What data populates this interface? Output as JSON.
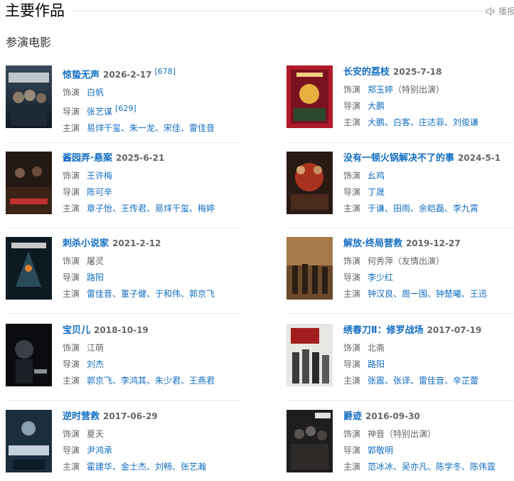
{
  "header": {
    "title": "主要作品",
    "play_label": "播报"
  },
  "section": {
    "title": "参演电影"
  },
  "labels": {
    "role": "饰演",
    "director": "导演",
    "cast": "主演"
  },
  "colors": {
    "link": "#136ec2",
    "muted": "#666666",
    "divider": "#ececec"
  },
  "movies": [
    {
      "title": "惊蛰无声",
      "date": "2026-2-17",
      "title_cite": "[678]",
      "role": "白帆",
      "role_note": "",
      "director": "张艺谋",
      "director_cite": "[629]",
      "cast": "易烊千玺、朱一龙、宋佳、雷佳音"
    },
    {
      "title": "长安的荔枝",
      "date": "2025-7-18",
      "title_cite": "",
      "role": "郑玉婷",
      "role_note": "（特别出演）",
      "director": "大鹏",
      "director_cite": "",
      "cast": "大鹏、白客、庄达菲、刘俊谦"
    },
    {
      "title": "酱园弄·悬案",
      "date": "2025-6-21",
      "title_cite": "",
      "role": "王许梅",
      "role_note": "",
      "director": "陈可辛",
      "director_cite": "",
      "cast": "章子怡、王传君、易烊千玺、梅婷"
    },
    {
      "title": "没有一顿火锅解决不了的事",
      "date": "2024-5-1",
      "title_cite": "",
      "role": "幺鸡",
      "role_note": "",
      "director": "丁晟",
      "director_cite": "",
      "cast": "于谦、田雨、余皑磊、李九霄"
    },
    {
      "title": "刺杀小说家",
      "date": "2021-2-12",
      "title_cite": "",
      "role": "屠灵",
      "role_plain": true,
      "role_note": "",
      "director": "路阳",
      "director_cite": "",
      "cast": "雷佳音、董子健、于和伟、郭京飞"
    },
    {
      "title": "解放·终局营救",
      "date": "2019-12-27",
      "title_cite": "",
      "role": "何秀萍",
      "role_plain": true,
      "role_note": "（友情出演）",
      "director": "李少红",
      "director_cite": "",
      "cast": "钟汉良、周一围、钟楚曦、王迅"
    },
    {
      "title": "宝贝儿",
      "date": "2018-10-19",
      "title_cite": "",
      "role": "江萌",
      "role_plain": true,
      "role_note": "",
      "director": "刘杰",
      "director_cite": "",
      "cast": "郭京飞、李鸿其、朱少君、王燕君"
    },
    {
      "title": "绣春刀Ⅱ：修罗战场",
      "date": "2017-07-19",
      "title_cite": "",
      "role": "北斋",
      "role_plain": true,
      "role_note": "",
      "director": "路阳",
      "director_cite": "",
      "cast": "张震、张译、雷佳音、辛芷蕾"
    },
    {
      "title": "逆时营救",
      "date": "2017-06-29",
      "title_cite": "",
      "role": "夏天",
      "role_plain": true,
      "role_note": "",
      "director": "尹鸿承",
      "director_cite": "",
      "cast": "霍建华、金士杰、刘畅、张艺瀚"
    },
    {
      "title": "爵迹",
      "date": "2016-09-30",
      "title_cite": "",
      "role": "神音",
      "role_plain": true,
      "role_note": "（特别出演）",
      "director": "郭敬明",
      "director_cite": "",
      "cast": "范冰冰、吴亦凡、陈学冬、陈伟霆"
    }
  ]
}
